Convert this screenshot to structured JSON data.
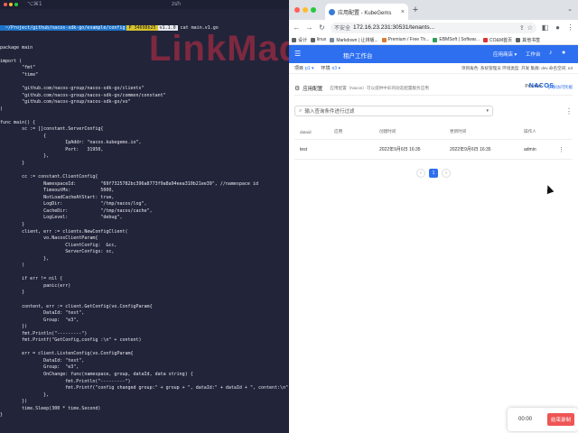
{
  "terminal": {
    "tab_left": "⌥⌘1",
    "tab_right": "zsh",
    "prompt": {
      "path": "~/Project/github/nacos-sdk-go/example/config",
      "git": "P 34698b25",
      "version": "v1.1.0"
    },
    "command": "cat main.v1.go",
    "watermark": "LinkMaq",
    "code": [
      "package main",
      "",
      "import (",
      "        \"fmt\"",
      "        \"time\"",
      "",
      "        \"github.com/nacos-group/nacos-sdk-go/clients\"",
      "        \"github.com/nacos-group/nacos-sdk-go/common/constant\"",
      "        \"github.com/nacos-group/nacos-sdk-go/vo\"",
      ")",
      "",
      "func main() {",
      "        sc := []constant.ServerConfig{",
      "                {",
      "                        IpAddr: \"nacos.kubegems.io\",",
      "                        Port:   31950,",
      "                },",
      "        }",
      "",
      "        cc := constant.ClientConfig{",
      "                NamespaceId:         \"69f7325782bc396a8773f9a8a94eea310b21ee39\", //namespace id",
      "                TimeoutMs:           5000,",
      "                NotLoadCacheAtStart: true,",
      "                LogDir:              \"/tmp/nacos/log\",",
      "                CacheDir:            \"/tmp/nacos/cache\",",
      "                LogLevel:            \"debug\",",
      "        }",
      "        client, err := clients.NewConfigClient(",
      "                vo.NacosClientParam{",
      "                        ClientConfig:  &cc,",
      "                        ServerConfigs: sc,",
      "                },",
      "        )",
      "",
      "        if err != nil {",
      "                panic(err)",
      "        }",
      "",
      "        content, err := client.GetConfig(vo.ConfigParam{",
      "                DataId: \"test\",",
      "                Group:  \"e3\",",
      "        })",
      "        fmt.Println(\"---------\")",
      "        fmt.Printf(\"GetConfig,config :\\n\" + content)",
      "",
      "        err = client.ListenConfig(vo.ConfigParam{",
      "                DataId: \"test\",",
      "                Group:  \"e3\",",
      "                OnChange: func(namespace, group, dataId, data string) {",
      "                        fmt.Println(\"---------\")",
      "                        fmt.Printf(\"config changed group:\" + group + \", dataId:\" + dataId + \", content:\\n\" + data)",
      "                },",
      "        })",
      "        time.Sleep(300 * time.Second)",
      "}"
    ]
  },
  "browser": {
    "tab_title": "应用配置 - KubeGems",
    "url": "172.16.23.231:30531/tenants...",
    "insecure_label": "不安全",
    "bookmarks": [
      "设计",
      "linux",
      "Markdown | 让排版...",
      "Premium / Free Th...",
      "EBMSoft | Softwar...",
      "CO&M首页",
      "其他书签"
    ]
  },
  "app": {
    "title": "租户工作台",
    "app_switch": "应用商店 ▾",
    "workspace": "工作台",
    "context": {
      "project_label": "项目",
      "project_value": "p1 ▾",
      "env_label": "环境",
      "env_value": "e3 ▾",
      "right_info": "项目角色: 系统管理员   环境类型: 开发   集群: dev   命名空间: e3"
    },
    "service": {
      "name": "应用配置",
      "desc": "应用配置（Nacos）可以提供中彩的动态配置服务应用",
      "provider_label": "Provider",
      "provider_logo": "NACOS.",
      "link": "获取访问凭据"
    },
    "search": {
      "placeholder": "输入查询条件进行过滤"
    },
    "table": {
      "headers": [
        "dataid",
        "应用",
        "创建时间",
        "更新时间",
        "操作人"
      ],
      "rows": [
        {
          "dataid": "test",
          "group": "",
          "created": "2022年9月6日 16:35",
          "updated": "2022年9月6日 16:35",
          "operator": "admin"
        }
      ]
    },
    "pager": {
      "prev": "‹",
      "current": "1",
      "next": "›"
    }
  },
  "recorder": {
    "time": "00:00",
    "button": "结束录制"
  },
  "colors": {
    "accent": "#2e6ff0",
    "terminal_bg": "#22243a",
    "prompt_path": "#1e73c8",
    "prompt_git": "#d9c32a",
    "watermark": "#c82d46"
  }
}
